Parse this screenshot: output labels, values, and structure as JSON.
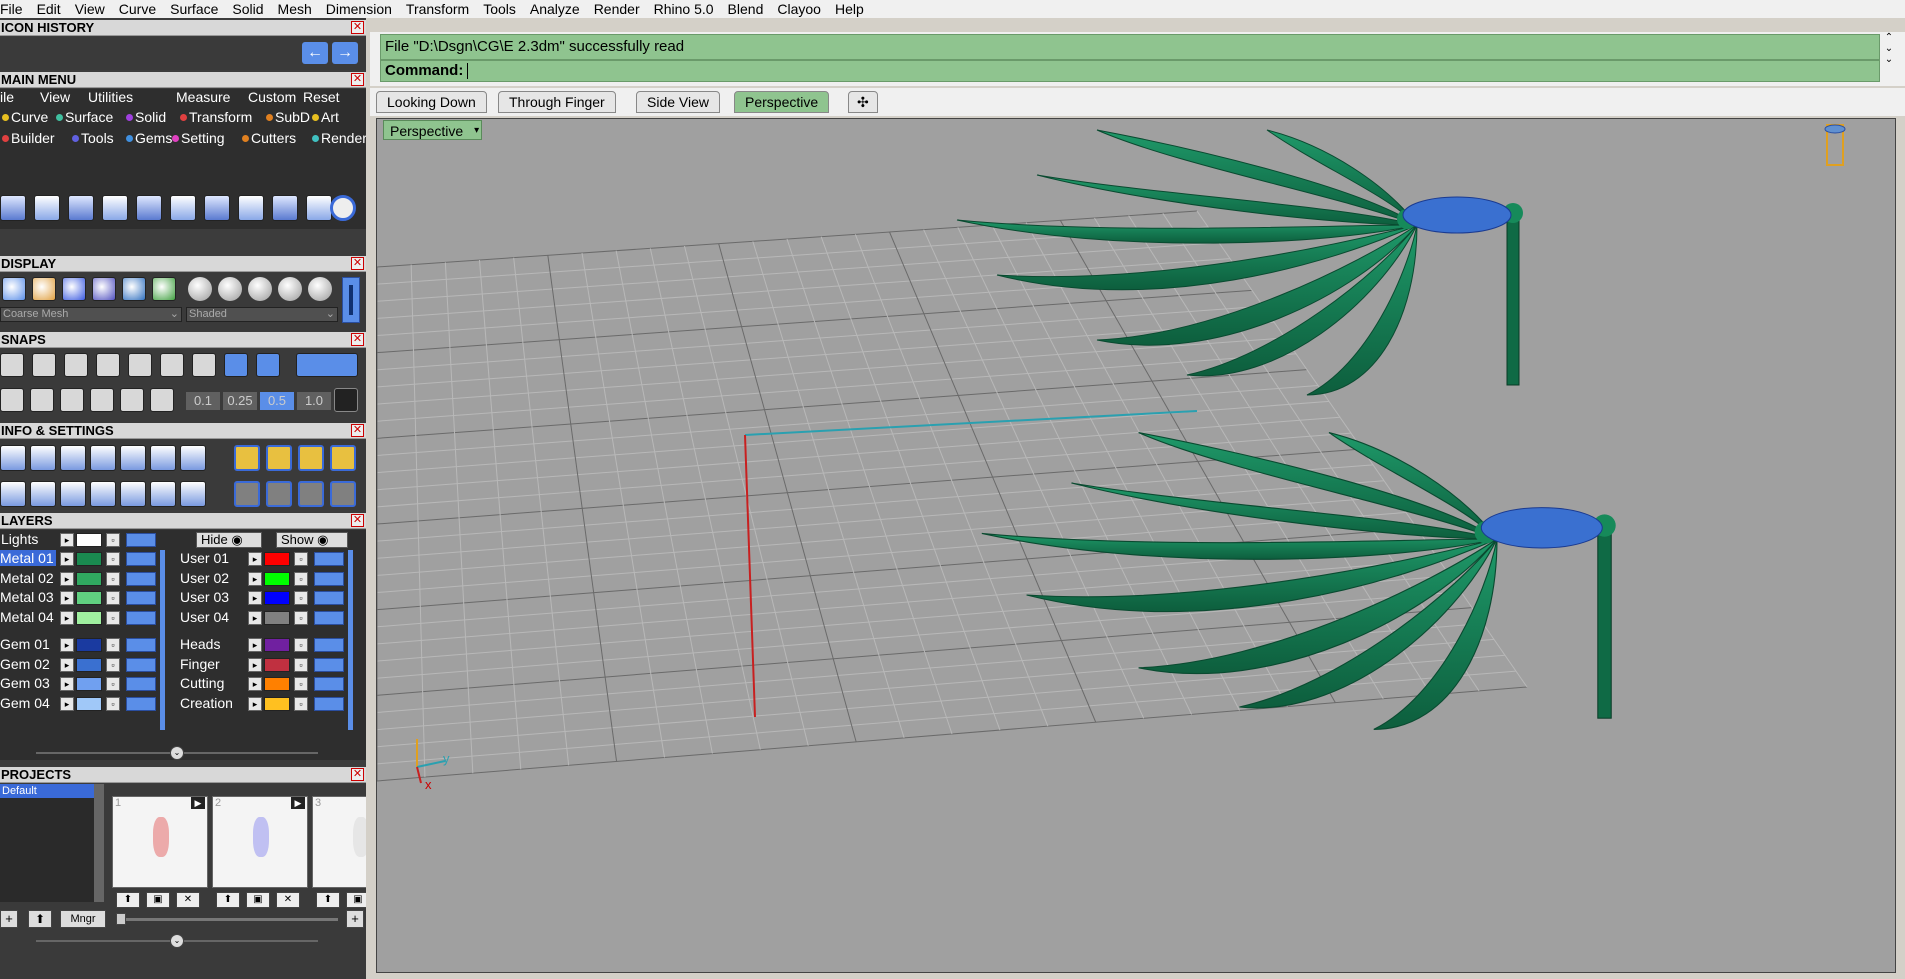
{
  "menubar": [
    "File",
    "Edit",
    "View",
    "Curve",
    "Surface",
    "Solid",
    "Mesh",
    "Dimension",
    "Transform",
    "Tools",
    "Analyze",
    "Render",
    "Rhino 5.0",
    "Blend",
    "Clayoo",
    "Help"
  ],
  "panels": {
    "icon_history": "ICON HISTORY",
    "main_menu": "MAIN MENU",
    "display": "DISPLAY",
    "snaps": "SNAPS",
    "info_settings": "INFO & SETTINGS",
    "layers": "LAYERS",
    "projects": "PROJECTS"
  },
  "main_menu": {
    "row1": [
      "ile",
      "View",
      "Utilities",
      "Measure",
      "Custom"
    ],
    "reset": "Reset",
    "row2": [
      {
        "label": "Curve",
        "color": "#e8c020"
      },
      {
        "label": "Surface",
        "color": "#40c0a0"
      },
      {
        "label": "Solid",
        "color": "#a040e0"
      },
      {
        "label": "Transform",
        "color": "#e04040"
      },
      {
        "label": "SubD",
        "color": "#e08020"
      },
      {
        "label": "Art",
        "color": "#e8c020"
      }
    ],
    "row3": [
      {
        "label": "Builder",
        "color": "#e04040"
      },
      {
        "label": "Tools",
        "color": "#6060e0"
      },
      {
        "label": "Gems",
        "color": "#4090e0"
      },
      {
        "label": "Setting",
        "color": "#e040c0"
      },
      {
        "label": "Cutters",
        "color": "#e08020"
      },
      {
        "label": "Render",
        "color": "#40c0c0"
      }
    ]
  },
  "display": {
    "mesh_select": "Coarse Mesh",
    "shade_select": "Shaded"
  },
  "snaps": {
    "values": [
      "0.1",
      "0.25",
      "0.5",
      "1.0"
    ]
  },
  "layers": {
    "lights_label": "Lights",
    "hide_label": "Hide",
    "show_label": "Show",
    "left": [
      {
        "name": "Metal 01",
        "color": "#1a8a50"
      },
      {
        "name": "Metal 02",
        "color": "#30a860"
      },
      {
        "name": "Metal 03",
        "color": "#60d080"
      },
      {
        "name": "Metal 04",
        "color": "#a0f0a0"
      },
      {
        "name": "Gem 01",
        "color": "#1a3aa0"
      },
      {
        "name": "Gem 02",
        "color": "#3a70d0"
      },
      {
        "name": "Gem 03",
        "color": "#70a0f0"
      },
      {
        "name": "Gem 04",
        "color": "#a0c8f8"
      }
    ],
    "right": [
      {
        "name": "User 01",
        "color": "#ff0000"
      },
      {
        "name": "User 02",
        "color": "#00ff00"
      },
      {
        "name": "User 03",
        "color": "#0000ff"
      },
      {
        "name": "User 04",
        "color": "#808080"
      },
      {
        "name": "Heads",
        "color": "#7020a0"
      },
      {
        "name": "Finger",
        "color": "#c03040"
      },
      {
        "name": "Cutting",
        "color": "#ff8000"
      },
      {
        "name": "Creation",
        "color": "#ffc020"
      }
    ]
  },
  "projects": {
    "default": "Default",
    "thumbs": [
      "1",
      "2",
      "3"
    ],
    "manager": "Mngr"
  },
  "command": {
    "history": "File \"D:\\Dsgn\\CG\\E 2.3dm\" successfully read",
    "prompt": "Command:"
  },
  "view_tabs": [
    "Looking Down",
    "Through Finger",
    "Side View",
    "Perspective"
  ],
  "active_tab": "Perspective",
  "viewport_label": "Perspective",
  "axis": {
    "x": "x",
    "y": "y"
  }
}
